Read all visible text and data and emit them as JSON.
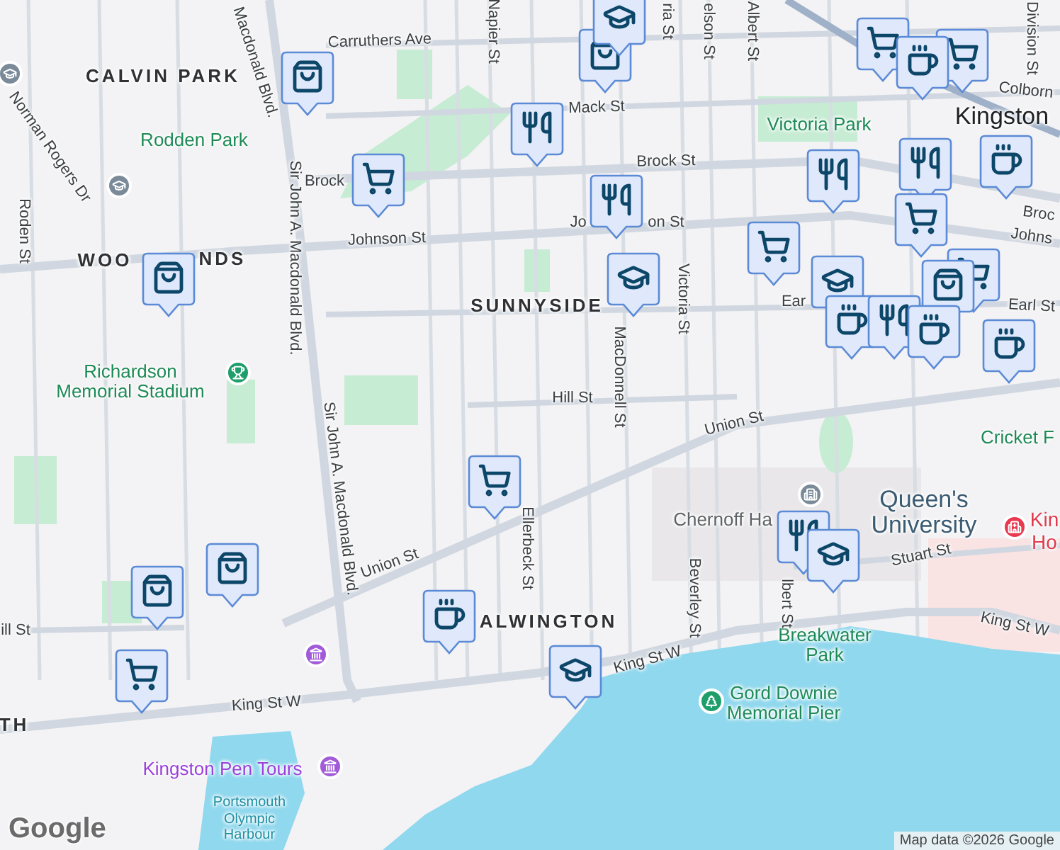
{
  "map": {
    "labels": [
      {
        "text": "Macdonald Blvd.",
        "kind": "street"
      },
      {
        "text": "Carruthers Ave",
        "kind": "street"
      },
      {
        "text": "CALVIN PARK",
        "kind": "district"
      },
      {
        "text": "Rodden Park",
        "kind": "park"
      },
      {
        "text": "Norman Rogers Dr",
        "kind": "street"
      },
      {
        "text": "Roden St",
        "kind": "street"
      },
      {
        "text": "Sir John A. Macdonald Blvd.",
        "kind": "street"
      },
      {
        "text": "Sir John A. Macdonald Blvd.",
        "kind": "street"
      },
      {
        "text": "Brock",
        "kind": "street"
      },
      {
        "text": "Johnson St",
        "kind": "street"
      },
      {
        "text": "WOO",
        "kind": "district"
      },
      {
        "text": "NDS",
        "kind": "district"
      },
      {
        "text": "Richardson Memorial Stadium",
        "kind": "park"
      },
      {
        "text": "Mack St",
        "kind": "street"
      },
      {
        "text": "Napier St",
        "kind": "street"
      },
      {
        "text": "ria St",
        "kind": "street"
      },
      {
        "text": "elson St",
        "kind": "street"
      },
      {
        "text": "Albert St",
        "kind": "street"
      },
      {
        "text": "Division St",
        "kind": "street"
      },
      {
        "text": "Colborn",
        "kind": "street"
      },
      {
        "text": "Victoria Park",
        "kind": "park"
      },
      {
        "text": "Kingston",
        "kind": "city"
      },
      {
        "text": "Brock St",
        "kind": "street"
      },
      {
        "text": "Broc",
        "kind": "street"
      },
      {
        "text": "Jo",
        "kind": "street"
      },
      {
        "text": "on St",
        "kind": "street"
      },
      {
        "text": "Johns",
        "kind": "street"
      },
      {
        "text": "Victoria St",
        "kind": "street"
      },
      {
        "text": "SUNNYSIDE",
        "kind": "district"
      },
      {
        "text": "Ear",
        "kind": "street"
      },
      {
        "text": "Earl St",
        "kind": "street"
      },
      {
        "text": "MacDonnell St",
        "kind": "street"
      },
      {
        "text": "Hill St",
        "kind": "street"
      },
      {
        "text": "Union St",
        "kind": "street"
      },
      {
        "text": "Cricket F",
        "kind": "park"
      },
      {
        "text": "Chernoff Ha",
        "kind": "poi"
      },
      {
        "text": "Queen's University",
        "kind": "university"
      },
      {
        "text": "Kin",
        "kind": "hospital"
      },
      {
        "text": "Ho",
        "kind": "hospital"
      },
      {
        "text": "Stuart St",
        "kind": "street"
      },
      {
        "text": "King St W",
        "kind": "street"
      },
      {
        "text": "Breakwater Park",
        "kind": "park"
      },
      {
        "text": "Beverley St",
        "kind": "street"
      },
      {
        "text": "lbert St",
        "kind": "street"
      },
      {
        "text": "Ellerbeck St",
        "kind": "street"
      },
      {
        "text": "ALWINGTON",
        "kind": "district"
      },
      {
        "text": "King St W",
        "kind": "street"
      },
      {
        "text": "Gord Downie Memorial Pier",
        "kind": "park"
      },
      {
        "text": "Union St",
        "kind": "street"
      },
      {
        "text": "ill St",
        "kind": "street"
      },
      {
        "text": "King St W",
        "kind": "street"
      },
      {
        "text": "TH",
        "kind": "district"
      },
      {
        "text": "Kingston Pen Tours",
        "kind": "museum"
      },
      {
        "text": "Portsmouth Olympic Harbour",
        "kind": "water"
      }
    ],
    "places": [
      {
        "kind": "school"
      },
      {
        "kind": "school"
      },
      {
        "kind": "stadium"
      },
      {
        "kind": "museum"
      },
      {
        "kind": "museum"
      },
      {
        "kind": "park"
      },
      {
        "kind": "building"
      },
      {
        "kind": "hospital"
      }
    ],
    "markers": [
      {
        "kind": "bag"
      },
      {
        "kind": "bag"
      },
      {
        "kind": "school"
      },
      {
        "kind": "food"
      },
      {
        "kind": "cart"
      },
      {
        "kind": "food"
      },
      {
        "kind": "school"
      },
      {
        "kind": "bag"
      },
      {
        "kind": "cart"
      },
      {
        "kind": "food"
      },
      {
        "kind": "food"
      },
      {
        "kind": "cup"
      },
      {
        "kind": "cart"
      },
      {
        "kind": "cart"
      },
      {
        "kind": "cart"
      },
      {
        "kind": "cup"
      },
      {
        "kind": "school"
      },
      {
        "kind": "cart"
      },
      {
        "kind": "bag"
      },
      {
        "kind": "cup"
      },
      {
        "kind": "food"
      },
      {
        "kind": "cup"
      },
      {
        "kind": "cup"
      },
      {
        "kind": "cart"
      },
      {
        "kind": "bag"
      },
      {
        "kind": "bag"
      },
      {
        "kind": "cart"
      },
      {
        "kind": "cup"
      },
      {
        "kind": "school"
      },
      {
        "kind": "food"
      },
      {
        "kind": "school"
      }
    ]
  },
  "logo": "Google",
  "attribution": "Map data ©2026 Google"
}
